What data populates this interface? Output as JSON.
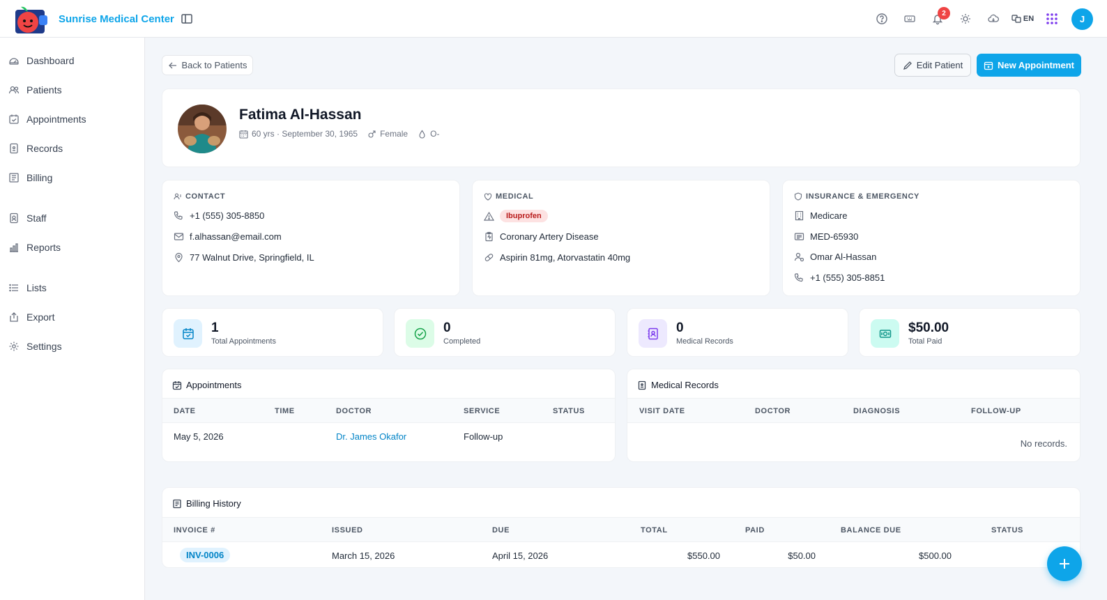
{
  "app": {
    "title": "Sunrise Medical Center",
    "brand_color": "#0ea5e9"
  },
  "topbar": {
    "icons": [
      "help-icon",
      "keyboard-icon",
      "bell-icon",
      "sun-icon",
      "cloud-icon",
      "translate-icon",
      "apps-grid-icon"
    ],
    "notification_count": "2",
    "language": "EN",
    "avatar_initial": "J"
  },
  "sidebar": {
    "items": [
      {
        "label": "Dashboard",
        "icon": "gauge-icon"
      },
      {
        "label": "Patients",
        "icon": "users-icon"
      },
      {
        "label": "Appointments",
        "icon": "calendar-check-icon"
      },
      {
        "label": "Records",
        "icon": "file-icon"
      },
      {
        "label": "Billing",
        "icon": "receipt-icon"
      },
      {
        "label": "Staff",
        "icon": "badge-icon"
      },
      {
        "label": "Reports",
        "icon": "bar-chart-icon"
      },
      {
        "label": "Lists",
        "icon": "list-icon"
      },
      {
        "label": "Export",
        "icon": "export-icon"
      },
      {
        "label": "Settings",
        "icon": "gear-icon"
      }
    ]
  },
  "actions": {
    "back": "Back to Patients",
    "edit": "Edit Patient",
    "new_appointment": "New Appointment"
  },
  "patient": {
    "name": "Fatima Al-Hassan",
    "age_dob": "60 yrs · September 30, 1965",
    "gender": "Female",
    "blood_type": "O-"
  },
  "contact": {
    "title": "CONTACT",
    "phone": "+1 (555) 305-8850",
    "email": "f.alhassan@email.com",
    "address": "77 Walnut Drive, Springfield, IL"
  },
  "medical": {
    "title": "MEDICAL",
    "allergy": "Ibuprofen",
    "condition": "Coronary Artery Disease",
    "medications": "Aspirin 81mg, Atorvastatin 40mg"
  },
  "insurance": {
    "title": "INSURANCE & EMERGENCY",
    "provider": "Medicare",
    "policy": "MED-65930",
    "emergency_contact": "Omar Al-Hassan",
    "emergency_phone": "+1 (555) 305-8851"
  },
  "stats": [
    {
      "value": "1",
      "label": "Total Appointments",
      "color": "#0ea5e9"
    },
    {
      "value": "0",
      "label": "Completed",
      "color": "#16a34a"
    },
    {
      "value": "0",
      "label": "Medical Records",
      "color": "#7c3aed"
    },
    {
      "value": "$50.00",
      "label": "Total Paid",
      "color": "#0d9488"
    }
  ],
  "appointments": {
    "title": "Appointments",
    "columns": [
      "DATE",
      "TIME",
      "DOCTOR",
      "SERVICE",
      "STATUS"
    ],
    "rows": [
      {
        "date": "May 5, 2026",
        "time": "",
        "doctor": "Dr. James Okafor",
        "service": "Follow-up",
        "status": ""
      }
    ]
  },
  "medical_records": {
    "title": "Medical Records",
    "columns": [
      "VISIT DATE",
      "DOCTOR",
      "DIAGNOSIS",
      "FOLLOW-UP"
    ],
    "empty": "No records."
  },
  "billing": {
    "title": "Billing History",
    "columns": [
      "INVOICE #",
      "ISSUED",
      "DUE",
      "TOTAL",
      "PAID",
      "BALANCE DUE",
      "STATUS"
    ],
    "rows": [
      {
        "invoice": "INV-0006",
        "issued": "March 15, 2026",
        "due": "April 15, 2026",
        "total": "$550.00",
        "paid": "$50.00",
        "balance": "$500.00",
        "status": ""
      }
    ]
  }
}
